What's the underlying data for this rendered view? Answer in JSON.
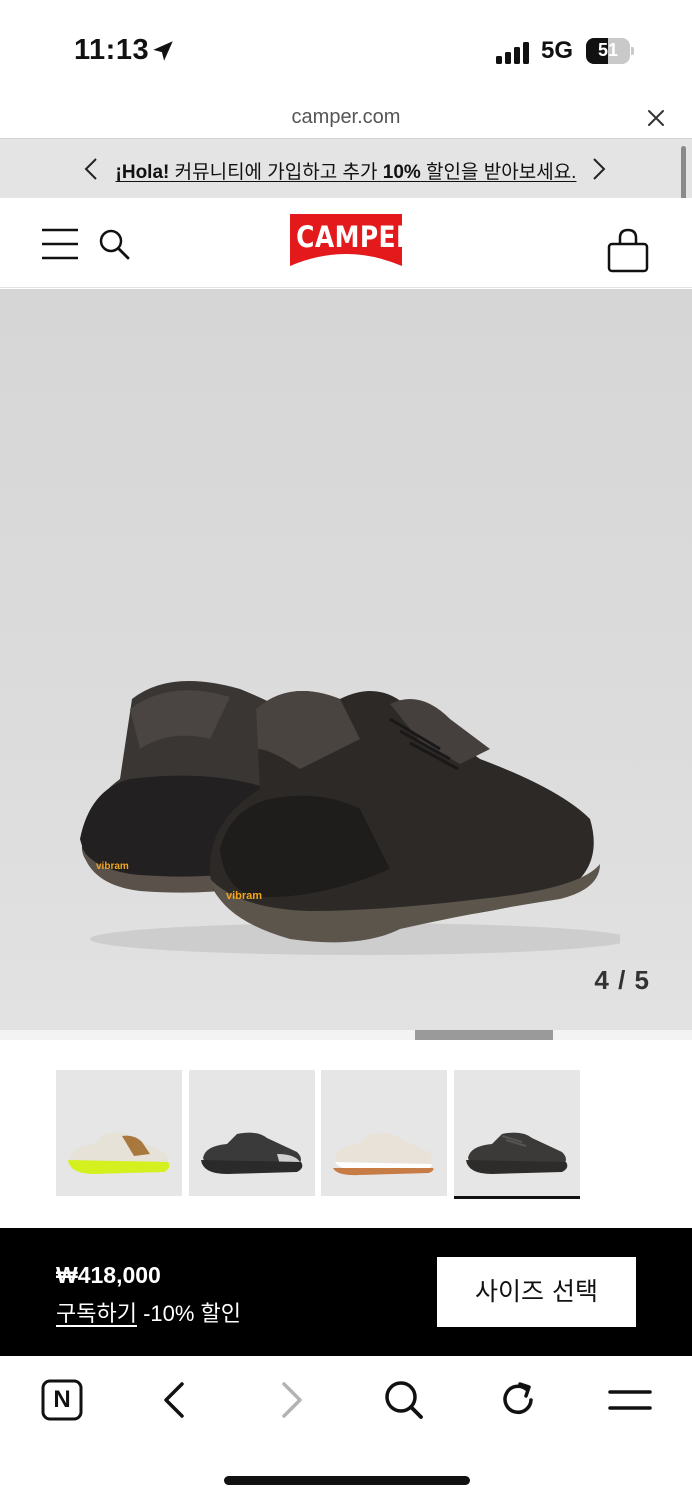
{
  "status_bar": {
    "time": "11:13",
    "network": "5G",
    "battery_level": "51",
    "battery_fraction": 0.51
  },
  "url_bar": {
    "url": "camper.com"
  },
  "promo": {
    "lead": "¡Hola!",
    "text_mid": " 커뮤니티에 가입하고 추가 ",
    "highlight": "10%",
    "text_end": " 할인을 받아보세요."
  },
  "header": {
    "logo_text": "CAMPER",
    "brand_color": "#e3191b"
  },
  "gallery": {
    "counter": "4 / 5",
    "current": 4,
    "total": 5
  },
  "thumbnails": [
    {
      "alt": "thumbnail-1",
      "sole_color": "#d4f01e",
      "upper_color": "#e6e2d8",
      "accent": "#a8783f"
    },
    {
      "alt": "thumbnail-2",
      "sole_color": "#2a2a2a",
      "upper_color": "#3a3a3a",
      "accent": "#cfcfcf"
    },
    {
      "alt": "thumbnail-3",
      "sole_color": "#c77b45",
      "upper_color": "#e8e2d8",
      "accent": "#ffffff"
    },
    {
      "alt": "thumbnail-4",
      "sole_color": "#2e2c2a",
      "upper_color": "#3c3a38",
      "accent": "#555"
    }
  ],
  "active_thumbnail": 4,
  "buybar": {
    "price": "₩418,000",
    "subscribe_link": "구독하기",
    "subscribe_discount": " -10% 할인",
    "size_button": "사이즈 선택"
  },
  "browser_toolbar": {
    "tabs_label": "N"
  }
}
